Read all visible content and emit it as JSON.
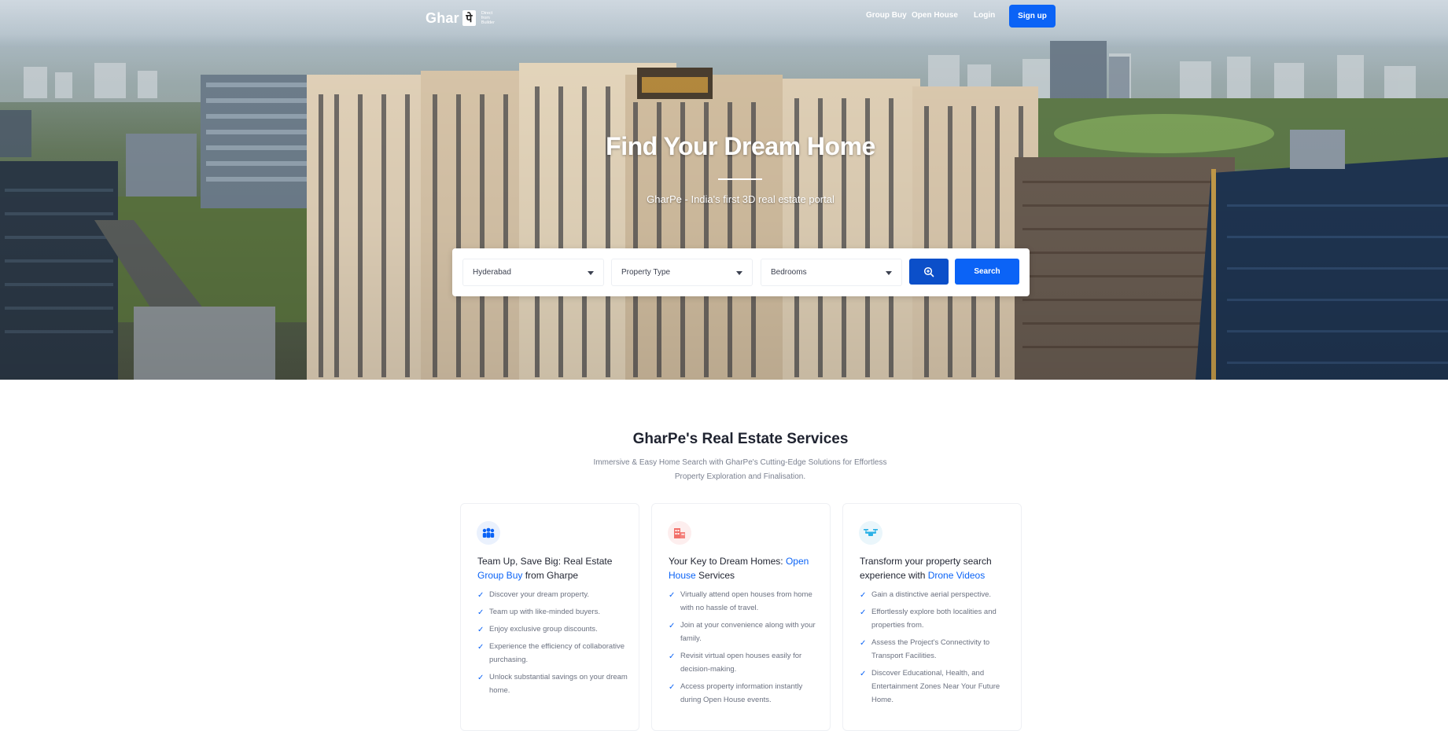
{
  "nav": {
    "logo_text": "Ghar",
    "logo_mark": "पे",
    "logo_tagline": [
      "Direct",
      "from",
      "Builder"
    ],
    "links": {
      "group_buy": "Group Buy",
      "open_house": "Open House",
      "login": "Login"
    },
    "signup_label": "Sign up"
  },
  "hero": {
    "title": "Find Your Dream Home",
    "subtitle": "GharPe - India's first 3D real estate portal"
  },
  "search": {
    "city": "Hyderabad",
    "property_type": "Property Type",
    "bedrooms": "Bedrooms",
    "search_label": "Search",
    "zoom_icon": "zoom-in-icon"
  },
  "services": {
    "title": "GharPe's Real Estate Services",
    "subtitle": "Immersive & Easy Home Search with GharPe's Cutting-Edge Solutions for Effortless Property Exploration and Finalisation.",
    "cards": [
      {
        "icon": "group-icon",
        "heading_pre": "Team Up, Save Big: Real Estate ",
        "heading_hl": "Group Buy",
        "heading_post": " from Gharpe",
        "items": [
          "Discover your dream property.",
          "Team up with like-minded buyers.",
          "Enjoy exclusive group discounts.",
          "Experience the efficiency of collaborative purchasing.",
          "Unlock substantial savings on your dream home."
        ]
      },
      {
        "icon": "building-icon",
        "heading_pre": "Your Key to Dream Homes: ",
        "heading_hl": "Open House",
        "heading_post": " Services",
        "items": [
          "Virtually attend open houses from home with no hassle of travel.",
          "Join at your convenience along with your family.",
          "Revisit virtual open houses easily for decision-making.",
          "Access property information instantly during Open House events."
        ]
      },
      {
        "icon": "drone-icon",
        "heading_pre": "Transform your property search experience with ",
        "heading_hl": "Drone Videos",
        "heading_post": "",
        "items": [
          "Gain a distinctive aerial perspective.",
          "Effortlessly explore both localities and properties from.",
          "Assess the Project's Connectivity to Transport Facilities.",
          "Discover Educational, Health, and Entertainment Zones Near Your Future Home."
        ]
      }
    ]
  },
  "colors": {
    "accent": "#0b63f6",
    "accent_dark": "#0b4fc9",
    "heading": "#1f2330",
    "muted": "#6b7180"
  }
}
